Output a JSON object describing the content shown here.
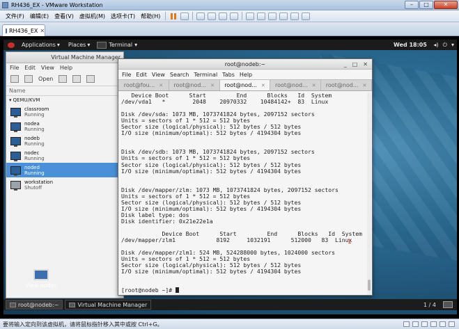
{
  "host": {
    "window_title": "RH436_EX - VMware Workstation",
    "menu": [
      "文件(F)",
      "编辑(E)",
      "查看(V)",
      "虚拟机(M)",
      "选项卡(T)",
      "帮助(H)"
    ],
    "tab_label": "RH436_EX",
    "status_text": "要将输入定向到该虚拟机，请将鼠标指针移入其中或按 Ctrl+G。",
    "win_buttons": {
      "min": "–",
      "max": "□",
      "close": "✕"
    }
  },
  "guest": {
    "topbar": {
      "applications": "Applications",
      "places": "Places",
      "terminal_app": "Terminal",
      "clock": "Wed 18:05",
      "dropdown": "▾"
    },
    "vmm": {
      "title": "Virtual Machine Manager",
      "menu": [
        "File",
        "Edit",
        "View",
        "Help"
      ],
      "toolbar_open": "Open",
      "col_name": "Name",
      "connection": "QEMU/KVM",
      "vms": [
        {
          "name": "classroom",
          "state": "Running"
        },
        {
          "name": "nodea",
          "state": "Running"
        },
        {
          "name": "nodeb",
          "state": "Running"
        },
        {
          "name": "nodec",
          "state": "Running"
        },
        {
          "name": "noded",
          "state": "Running"
        },
        {
          "name": "workstation",
          "state": "Shutoff"
        }
      ]
    },
    "desktop_icon": "View nodec",
    "terminal": {
      "title": "root@nodeb:~",
      "controls": [
        "_",
        "□",
        "✕"
      ],
      "menu": [
        "File",
        "Edit",
        "View",
        "Search",
        "Terminal",
        "Tabs",
        "Help"
      ],
      "tabs": [
        "root@fou...",
        "root@nod...",
        "root@nod...",
        "root@nod...",
        "root@nod..."
      ],
      "active_tab": 2,
      "lines": [
        "   Device Boot      Start         End      Blocks   Id  System",
        "/dev/vda1   *        2048    20970332    10484142+  83  Linux",
        "",
        "Disk /dev/sda: 1073 MB, 1073741824 bytes, 2097152 sectors",
        "Units = sectors of 1 * 512 = 512 bytes",
        "Sector size (logical/physical): 512 bytes / 512 bytes",
        "I/O size (minimum/optimal): 512 bytes / 4194304 bytes",
        "",
        "",
        "Disk /dev/sdb: 1073 MB, 1073741824 bytes, 2097152 sectors",
        "Units = sectors of 1 * 512 = 512 bytes",
        "Sector size (logical/physical): 512 bytes / 512 bytes",
        "I/O size (minimum/optimal): 512 bytes / 4194304 bytes",
        "",
        "",
        "Disk /dev/mapper/zlm: 1073 MB, 1073741824 bytes, 2097152 sectors",
        "Units = sectors of 1 * 512 = 512 bytes",
        "Sector size (logical/physical): 512 bytes / 512 bytes",
        "I/O size (minimum/optimal): 512 bytes / 4194304 bytes",
        "Disk label type: dos",
        "Disk identifier: 0x21e22e1a",
        "",
        "            Device Boot      Start         End      Blocks   Id  System",
        "/dev/mapper/zlm1            8192     1032191      512000   83  Linux",
        "",
        "Disk /dev/mapper/zlm1: 524 MB, 524288000 bytes, 1024000 sectors",
        "Units = sectors of 1 * 512 = 512 bytes",
        "Sector size (logical/physical): 512 bytes / 512 bytes",
        "I/O size (minimum/optimal): 512 bytes / 4194304 bytes",
        "",
        "",
        "[root@nodeb ~]# "
      ]
    },
    "annotation": "1",
    "taskbar": {
      "items": [
        "root@nodeb:~",
        "Virtual Machine Manager"
      ],
      "pager": "1 / 4"
    }
  }
}
